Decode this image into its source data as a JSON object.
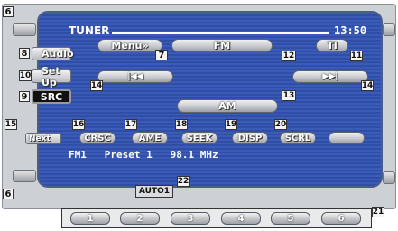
{
  "screen": {
    "title": "TUNER",
    "clock": "13:50",
    "info_line": "FM1   Preset 1   98.1 MHz"
  },
  "buttons": {
    "menu": "Menu»",
    "fm": "FM",
    "ti": "TI",
    "prev": "|◀◀",
    "next": "▶▶|",
    "am": "AM",
    "audio": "Audio",
    "setup": "Set Up",
    "src": "SRC",
    "next_tab": "Next",
    "crsc": "CRSC",
    "ame": "AME",
    "seek": "SEEK",
    "disp": "DISP",
    "scrl": "SCRL",
    "auto": "AUTO1"
  },
  "presets": [
    "1",
    "2",
    "3",
    "4",
    "5",
    "6"
  ],
  "callouts": {
    "c6a": "6",
    "c6b": "6",
    "c7": "7",
    "c8": "8",
    "c9": "9",
    "c10": "10",
    "c11": "11",
    "c12": "12",
    "c13": "13",
    "c14a": "14",
    "c14b": "14",
    "c15": "15",
    "c16": "16",
    "c17": "17",
    "c18": "18",
    "c19": "19",
    "c20": "20",
    "c21": "21",
    "c22": "22"
  },
  "colors": {
    "screen_blue": "#3b5bb8",
    "frame_gray": "#cdd0d5",
    "src_black": "#111111"
  }
}
